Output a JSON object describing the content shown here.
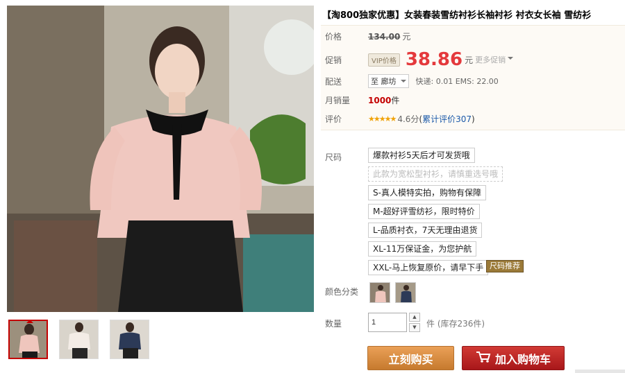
{
  "product": {
    "title": "【淘800独家优惠】女装春装雪纺衬衫长袖衬衫 衬衣女长袖 雪纺衫"
  },
  "price": {
    "label": "价格",
    "original": "134.00",
    "unit": "元"
  },
  "promo": {
    "label": "促销",
    "vip_tag": "VIP价格",
    "price": "38.86",
    "unit": "元",
    "more": "更多促销"
  },
  "shipping": {
    "label": "配送",
    "region": "至 廊坊",
    "fees": "快递: 0.01 EMS: 22.00"
  },
  "monthly_sales": {
    "label": "月销量",
    "count": "1000",
    "unit": "件"
  },
  "rating": {
    "label": "评价",
    "stars": "★★★★★",
    "score": "4.6分",
    "open_paren": "(",
    "reviews_text": "累计评价307",
    "close_paren": ")"
  },
  "size": {
    "label": "尺码",
    "options": [
      {
        "text": "爆款衬衫5天后才可发货哦"
      },
      {
        "text": "此款为宽松型衬衫，请慎重选号哦"
      },
      {
        "text": "S-真人模特实拍，购物有保障"
      },
      {
        "text": "M-超好评雪纺衫，限时特价"
      },
      {
        "text": "L-品质衬衣，7天无理由退货"
      },
      {
        "text": "XL-11万保证金，为您护航"
      },
      {
        "text": "XXL-马上恢复原价，请早下手"
      }
    ],
    "badge": "尺码推荐"
  },
  "color": {
    "label": "颜色分类"
  },
  "quantity": {
    "label": "数量",
    "value": "1",
    "unit": "件",
    "stock": "(库存236件)"
  },
  "buttons": {
    "buy_now": "立刻购买",
    "add_to_cart": "加入购物车"
  },
  "colors": {
    "price_red": "#e4393c",
    "buy_orange": "#d98a3e",
    "cart_red": "#b91f22",
    "link_blue": "#1a58a8",
    "star": "#f0a30a"
  },
  "icons": [
    "cart-icon",
    "caret-down-icon",
    "up-arrow-icon",
    "down-arrow-icon"
  ]
}
